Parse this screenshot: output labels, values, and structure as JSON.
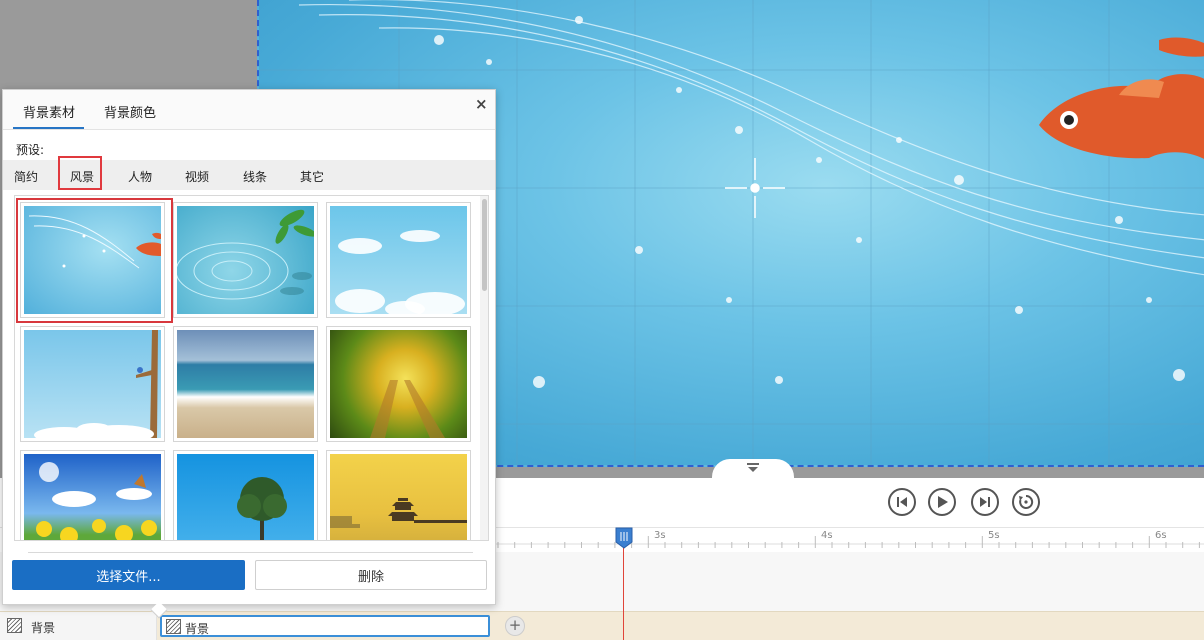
{
  "panel": {
    "tabs": [
      {
        "label": "背景素材",
        "active": true
      },
      {
        "label": "背景颜色",
        "active": false
      }
    ],
    "close_label": "×",
    "preset_label": "预设:",
    "categories": [
      {
        "label": "简约",
        "active": false
      },
      {
        "label": "风景",
        "active": true
      },
      {
        "label": "人物",
        "active": false
      },
      {
        "label": "视频",
        "active": false
      },
      {
        "label": "线条",
        "active": false
      },
      {
        "label": "其它",
        "active": false
      }
    ],
    "thumbnails": [
      {
        "name": "goldfish-underwater",
        "selected": true
      },
      {
        "name": "water-ripple-leaves",
        "selected": false
      },
      {
        "name": "blue-sky-clouds",
        "selected": false
      },
      {
        "name": "tree-bird-sky",
        "selected": false
      },
      {
        "name": "sea-beach",
        "selected": false
      },
      {
        "name": "motion-blur-rails",
        "selected": false
      },
      {
        "name": "flower-butterfly-field",
        "selected": false
      },
      {
        "name": "lone-tree-blue",
        "selected": false
      },
      {
        "name": "pagoda-sunset-lake",
        "selected": false
      }
    ],
    "choose_file_label": "选择文件...",
    "delete_label": "删除"
  },
  "playback": {
    "buttons": [
      "skip-back-icon",
      "play-icon",
      "skip-forward-icon",
      "loop-icon"
    ]
  },
  "timeline": {
    "ticks": [
      "3s",
      "4s",
      "5s",
      "6s"
    ],
    "track_label": "背景",
    "clip_label": "背景",
    "add_label": "+"
  },
  "colors": {
    "accent": "#1a6ec4",
    "selection": "#d8383d",
    "playhead": "#e0453a",
    "track": "#f3ead7"
  }
}
